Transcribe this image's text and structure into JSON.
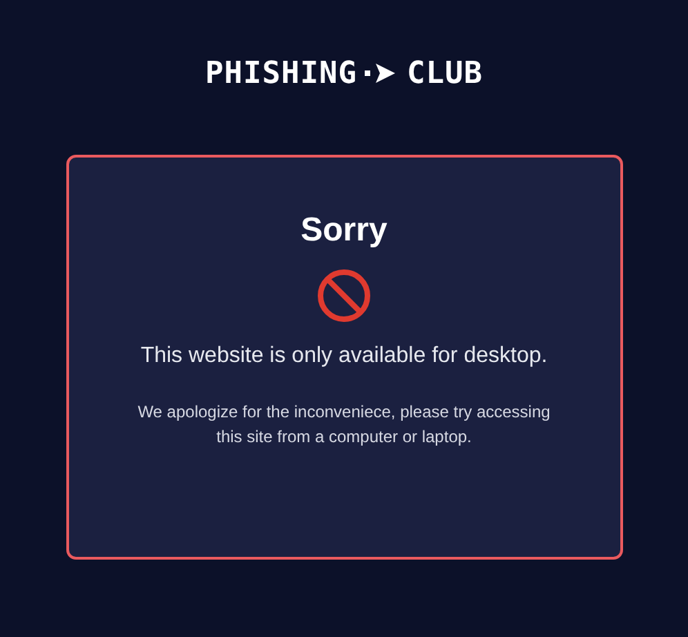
{
  "logo": {
    "left": "PHISHING",
    "right": "CLUB"
  },
  "card": {
    "title": "Sorry",
    "message": "This website is only available for desktop.",
    "detail": "We apologize for the inconveniece, please try accessing this site from a computer or laptop."
  }
}
